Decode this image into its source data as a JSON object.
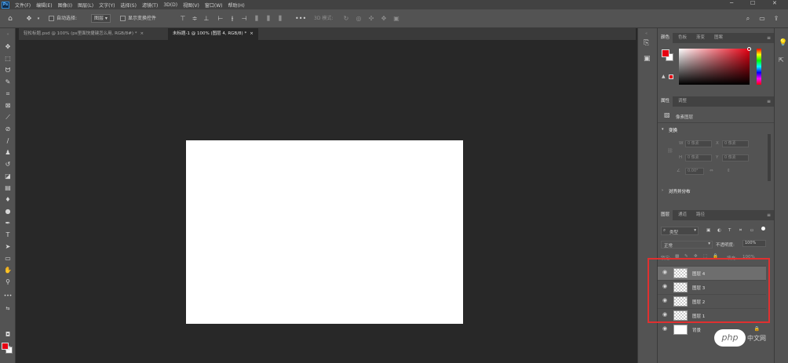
{
  "menubar": {
    "logo": "Ps",
    "items": [
      "文件(F)",
      "编辑(E)",
      "图像(I)",
      "图层(L)",
      "文字(Y)",
      "选择(S)",
      "滤镜(T)",
      "3D(D)",
      "视图(V)",
      "窗口(W)",
      "帮助(H)"
    ]
  },
  "options": {
    "auto_select_label": "自动选择:",
    "auto_select_value": "图层",
    "show_transform_label": "显示变换控件",
    "mode_3d_label": "3D 模式:"
  },
  "tabs": [
    {
      "label": "轻松标题.psd @ 100% (ps里面快捷键怎么用, RGB/8#) *",
      "close": "×"
    },
    {
      "label": "未标题-1 @ 100% (图层 4, RGB/8) *",
      "close": "×"
    }
  ],
  "color_panel": {
    "tabs": [
      "颜色",
      "色板",
      "渐变",
      "图案"
    ]
  },
  "properties_panel": {
    "tabs": [
      "属性",
      "调整"
    ],
    "pixel_layer_label": "像素图层",
    "transform_label": "变换",
    "w_label": "W",
    "h_label": "H",
    "x_label": "X",
    "y_label": "Y",
    "w_value": "0 像素",
    "h_value": "0 像素",
    "x_value": "0 像素",
    "y_value": "0 像素",
    "angle_value": "0.00°",
    "align_label": "对齐并分布"
  },
  "layers_panel": {
    "tabs": [
      "图层",
      "通道",
      "路径"
    ],
    "filter_kind": "类型",
    "blend_mode": "正常",
    "opacity_label": "不透明度:",
    "opacity_value": "100%",
    "lock_label": "锁定:",
    "fill_label": "填充:",
    "fill_value": "100%",
    "layers": [
      {
        "name": "图层 4",
        "selected": true
      },
      {
        "name": "图层 3",
        "selected": false
      },
      {
        "name": "图层 2",
        "selected": false
      },
      {
        "name": "图层 1",
        "selected": false
      },
      {
        "name": "背景",
        "selected": false
      }
    ]
  },
  "watermark": {
    "logo_text": "php",
    "site_text": "中文网"
  },
  "colors": {
    "foreground": "#e60012",
    "background": "#ffffff",
    "highlight_box": "#e03030"
  }
}
